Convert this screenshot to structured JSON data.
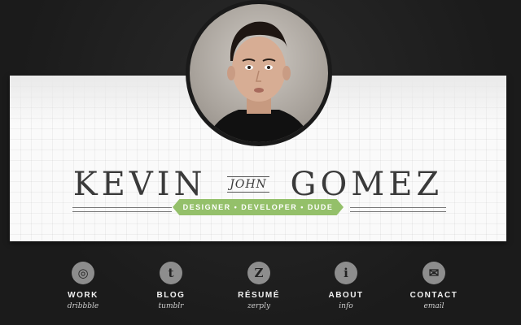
{
  "header": {
    "first_name": "KEVIN",
    "middle_name": "JOHN",
    "last_name": "GOMEZ",
    "tagline": "DESIGNER • DEVELOPER • DUDE"
  },
  "nav": {
    "items": [
      {
        "label": "WORK",
        "sub": "dribbble",
        "icon": "dribbble-icon",
        "glyph": "◎"
      },
      {
        "label": "BLOG",
        "sub": "tumblr",
        "icon": "tumblr-icon",
        "glyph": "t"
      },
      {
        "label": "RÉSUMÉ",
        "sub": "zerply",
        "icon": "zerply-icon",
        "glyph": "Z"
      },
      {
        "label": "ABOUT",
        "sub": "info",
        "icon": "info-icon",
        "glyph": "i"
      },
      {
        "label": "CONTACT",
        "sub": "email",
        "icon": "mail-icon",
        "glyph": "✉"
      }
    ]
  },
  "colors": {
    "accent": "#94c06a",
    "background": "#1f1f1f",
    "banner": "#fafafa"
  }
}
